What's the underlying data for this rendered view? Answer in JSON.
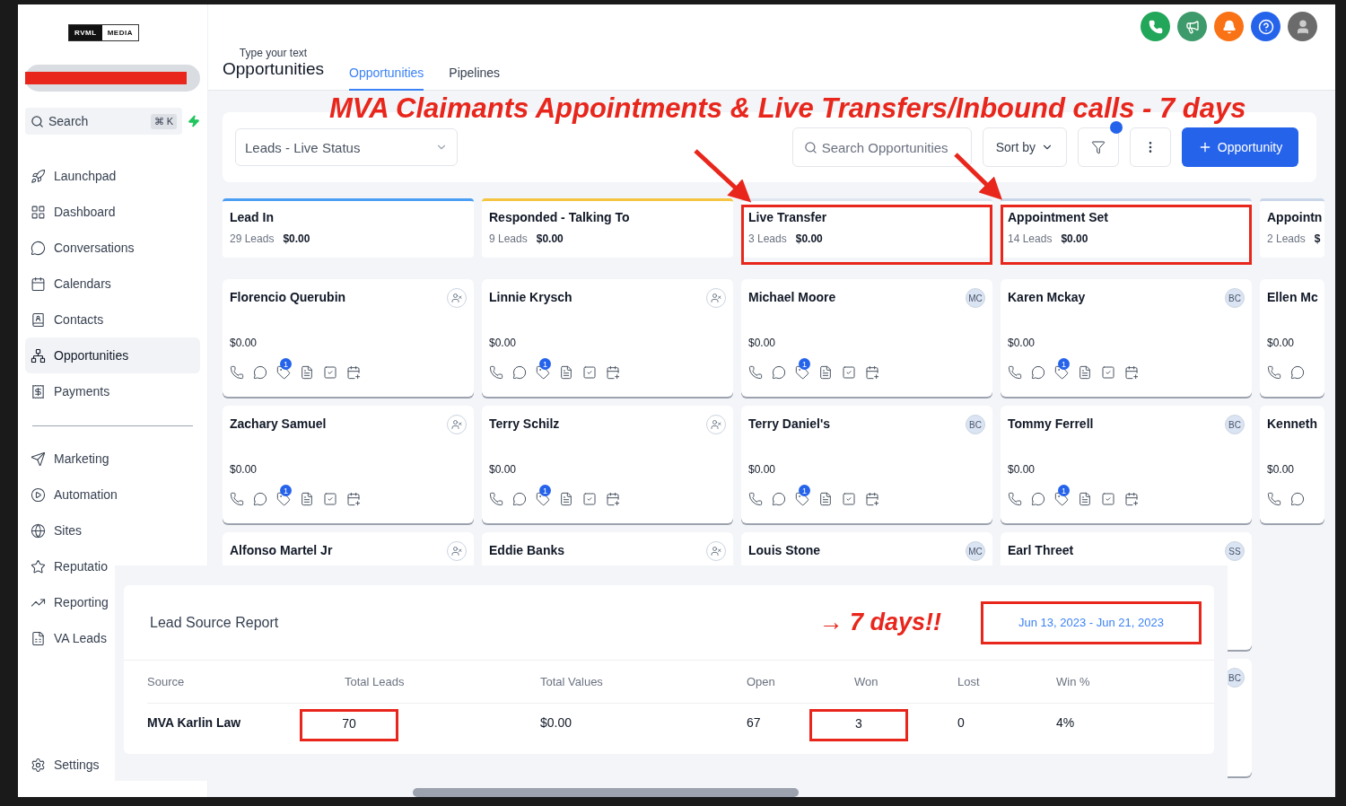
{
  "sidebar": {
    "logo": {
      "left": "RVML",
      "right": "MEDIA"
    },
    "search": {
      "placeholder": "Search",
      "shortcut": "⌘ K"
    },
    "items": [
      {
        "label": "Launchpad",
        "selected": false
      },
      {
        "label": "Dashboard",
        "selected": false
      },
      {
        "label": "Conversations",
        "selected": false
      },
      {
        "label": "Calendars",
        "selected": false
      },
      {
        "label": "Contacts",
        "selected": false
      },
      {
        "label": "Opportunities",
        "selected": true
      },
      {
        "label": "Payments",
        "selected": false
      }
    ],
    "items_2": [
      {
        "label": "Marketing",
        "selected": false
      },
      {
        "label": "Automation",
        "selected": false
      },
      {
        "label": "Sites",
        "selected": false
      },
      {
        "label": "Reputatio",
        "selected": false
      },
      {
        "label": "Reporting",
        "selected": false
      },
      {
        "label": "VA Leads",
        "selected": false
      }
    ],
    "settings": "Settings"
  },
  "header": {
    "subtitle": "Type your text",
    "title": "Opportunities",
    "tabs": [
      {
        "label": "Opportunities",
        "selected": true
      },
      {
        "label": "Pipelines",
        "selected": false
      }
    ]
  },
  "annotation_title": "MVA Claimants Appointments & Live Transfers/Inbound calls - 7 days",
  "toolbar": {
    "pipeline": "Leads - Live Status",
    "search": {
      "placeholder": "Search Opportunities"
    },
    "sort": "Sort by",
    "filter_active": true,
    "add": "Opportunity"
  },
  "stages": [
    {
      "name": "Lead In",
      "count": "29 Leads",
      "value": "$0.00",
      "color": "#4a9ff5",
      "highlighted": false,
      "partial": false,
      "cards": [
        {
          "name": "Florencio Querubin",
          "amount": "$0.00",
          "badge": "1",
          "avatar": {
            "kind": "unassigned"
          }
        },
        {
          "name": "Zachary Samuel",
          "amount": "$0.00",
          "badge": "1",
          "avatar": {
            "kind": "unassigned"
          }
        },
        {
          "name": "Alfonso Martel Jr",
          "avatar": {
            "kind": "unassigned"
          }
        }
      ]
    },
    {
      "name": "Responded - Talking To",
      "count": "9 Leads",
      "value": "$0.00",
      "color": "#f5c542",
      "highlighted": false,
      "partial": false,
      "cards": [
        {
          "name": "Linnie Krysch",
          "amount": "$0.00",
          "badge": "1",
          "avatar": {
            "kind": "unassigned"
          }
        },
        {
          "name": "Terry Schilz",
          "amount": "$0.00",
          "badge": "1",
          "avatar": {
            "kind": "unassigned"
          }
        },
        {
          "name": "Eddie Banks",
          "avatar": {
            "kind": "unassigned"
          }
        }
      ]
    },
    {
      "name": "Live Transfer",
      "count": "3 Leads",
      "value": "$0.00",
      "color": "#dfe6f0",
      "highlighted": true,
      "partial": false,
      "cards": [
        {
          "name": "Michael Moore",
          "amount": "$0.00",
          "badge": "1",
          "avatar": {
            "kind": "initials",
            "text": "MC"
          }
        },
        {
          "name": "Terry Daniel's",
          "amount": "$0.00",
          "badge": "1",
          "avatar": {
            "kind": "initials",
            "text": "BC"
          }
        },
        {
          "name": "Louis Stone",
          "avatar": {
            "kind": "initials",
            "text": "MC"
          }
        }
      ]
    },
    {
      "name": "Appointment Set",
      "count": "14 Leads",
      "value": "$0.00",
      "color": "#c9d6ea",
      "highlighted": true,
      "partial": false,
      "cards": [
        {
          "name": "Karen Mckay",
          "amount": "$0.00",
          "badge": "1",
          "avatar": {
            "kind": "initials",
            "text": "BC"
          }
        },
        {
          "name": "Tommy Ferrell",
          "amount": "$0.00",
          "badge": "1",
          "avatar": {
            "kind": "initials",
            "text": "BC"
          }
        },
        {
          "name": "Earl Threet",
          "avatar": {
            "kind": "initials",
            "text": "SS"
          }
        },
        {
          "avatar": {
            "kind": "initials",
            "text": "BC"
          }
        }
      ]
    },
    {
      "name": "Appointn",
      "count": "2 Leads",
      "value": "$",
      "color": "#c9d6ea",
      "highlighted": false,
      "partial": true,
      "cards": [
        {
          "name": "Ellen Mc",
          "amount": "$0.00"
        },
        {
          "name": "Kenneth",
          "amount": "$0.00"
        }
      ]
    }
  ],
  "report": {
    "title": "Lead Source Report",
    "annotation": "→ 7 days!!",
    "date_range": {
      "text": "Jun 13, 2023 - Jun 21, 2023",
      "highlighted": true
    },
    "columns": [
      "Source",
      "Total Leads",
      "Total Values",
      "Open",
      "Won",
      "Lost",
      "Win %"
    ],
    "rows": [
      {
        "cells": [
          {
            "text": "MVA Karlin Law",
            "highlighted": false
          },
          {
            "text": "70",
            "highlighted": true
          },
          {
            "text": "$0.00",
            "highlighted": false
          },
          {
            "text": "67",
            "highlighted": false
          },
          {
            "text": "3",
            "highlighted": true
          },
          {
            "text": "0",
            "highlighted": false
          },
          {
            "text": "4%",
            "highlighted": false
          }
        ]
      }
    ]
  }
}
